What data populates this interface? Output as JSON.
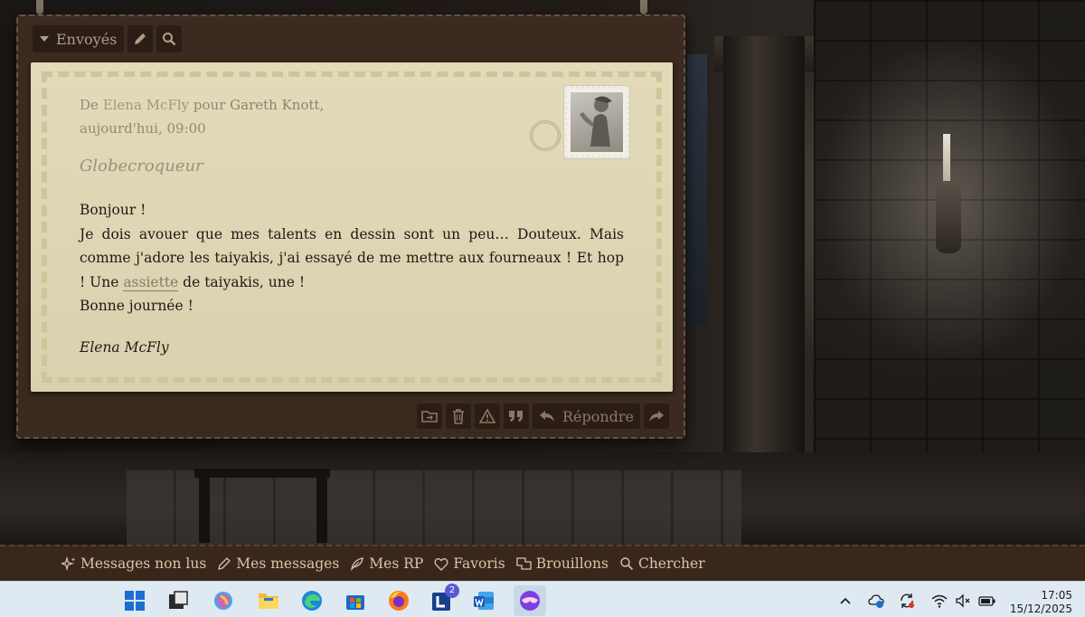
{
  "toolbar": {
    "folder_label": "Envoyés",
    "edit_icon": "pencil-icon",
    "search_icon": "search-icon"
  },
  "letter": {
    "meta_from_prefix": "De",
    "sender": "Elena McFly",
    "meta_to_prefix": "pour",
    "recipient": "Gareth Knott,",
    "date": "aujourd'hui, 09:00",
    "subject": "Globecroqueur",
    "body": {
      "line1": "Bonjour !",
      "para_start": "Je dois avouer que mes talents en dessin sont un peu… Douteux. Mais comme j'adore les taiyakis, j'ai essayé de me mettre aux fourneaux ! Et hop ! Une",
      "link_text": "assiette",
      "para_end": "de taiyakis, une !",
      "closing": "Bonne journée !"
    },
    "signature": "Elena McFly"
  },
  "actions": {
    "folder_icon": "folder-move-icon",
    "trash_icon": "trash-icon",
    "report_icon": "warning-icon",
    "quote_icon": "quote-icon",
    "reply_label": "Répondre",
    "forward_icon": "forward-icon"
  },
  "forum_bar": {
    "items": [
      {
        "label": "Messages non lus",
        "icon": "sparkle-icon"
      },
      {
        "label": "Mes messages",
        "icon": "pen-icon"
      },
      {
        "label": "Mes RP",
        "icon": "feather-icon"
      },
      {
        "label": "Favoris",
        "icon": "heart-icon"
      },
      {
        "label": "Brouillons",
        "icon": "drafts-icon"
      },
      {
        "label": "Chercher",
        "icon": "search-icon"
      }
    ]
  },
  "taskbar": {
    "word_badge": "2",
    "time": "17:05",
    "date": "15/12/2025"
  },
  "colors": {
    "frame": "#3a2a1f",
    "paper": "#e2dab9",
    "forum_bar": "#3a271b",
    "taskbar": "#dfe9f2"
  }
}
